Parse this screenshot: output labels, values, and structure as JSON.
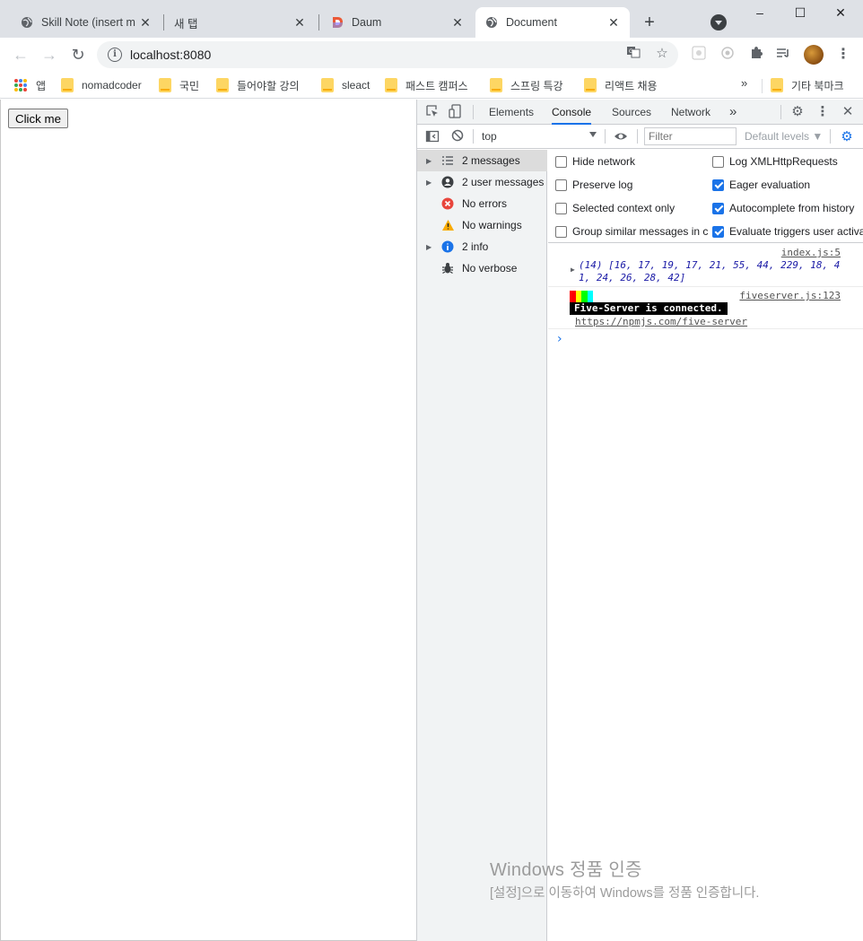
{
  "tabs": [
    {
      "title": "Skill Note (insert m",
      "active": false
    },
    {
      "title": "새 탭",
      "active": false
    },
    {
      "title": "Daum",
      "active": false
    },
    {
      "title": "Document",
      "active": true
    }
  ],
  "window_controls": {
    "minimize": "–",
    "maximize": "☐",
    "close": "✕"
  },
  "toolbar": {
    "url": "localhost:8080"
  },
  "bookmarks": {
    "apps_label": "앱",
    "items": [
      "nomadcoder",
      "국민",
      "들어야할 강의",
      "sleact",
      "패스트 캠퍼스",
      "스프링 특강",
      "리액트 채용"
    ],
    "more": "»",
    "other": "기타 북마크"
  },
  "page": {
    "button_label": "Click me"
  },
  "devtools": {
    "tabs": [
      "Elements",
      "Console",
      "Sources",
      "Network"
    ],
    "more_tabs": "»",
    "context": "top",
    "filter_placeholder": "Filter",
    "levels_label": "Default levels ▼",
    "sidebar": [
      {
        "label": "2 messages",
        "icon": "list-icon",
        "selected": true,
        "expandable": true
      },
      {
        "label": "2 user messages",
        "icon": "user-icon",
        "selected": false,
        "expandable": true
      },
      {
        "label": "No errors",
        "icon": "error-icon",
        "selected": false,
        "expandable": false
      },
      {
        "label": "No warnings",
        "icon": "warning-icon",
        "selected": false,
        "expandable": false
      },
      {
        "label": "2 info",
        "icon": "info-icon",
        "selected": false,
        "expandable": true
      },
      {
        "label": "No verbose",
        "icon": "bug-icon",
        "selected": false,
        "expandable": false
      }
    ],
    "settings_left": [
      {
        "label": "Hide network",
        "checked": false
      },
      {
        "label": "Preserve log",
        "checked": false
      },
      {
        "label": "Selected context only",
        "checked": false
      },
      {
        "label": "Group similar messages in c",
        "checked": false
      }
    ],
    "settings_right": [
      {
        "label": "Log XMLHttpRequests",
        "checked": false
      },
      {
        "label": "Eager evaluation",
        "checked": true
      },
      {
        "label": "Autocomplete from history",
        "checked": true
      },
      {
        "label": "Evaluate triggers user activa",
        "checked": true
      }
    ],
    "console": {
      "msg1_source": "index.js:5",
      "msg1_text": "(14) [16, 17, 19, 17, 21, 55, 44, 229, 18, 41, 24, 26, 28, 42]",
      "msg2_source": "fiveserver.js:123",
      "msg2_text": "Five-Server is connected.",
      "msg2_link": "https://npmjs.com/five-server",
      "prompt": "›"
    }
  },
  "watermark": {
    "line1": "Windows 정품 인증",
    "line2": "[설정]으로 이동하여 Windows를 정품 인증합니다."
  }
}
